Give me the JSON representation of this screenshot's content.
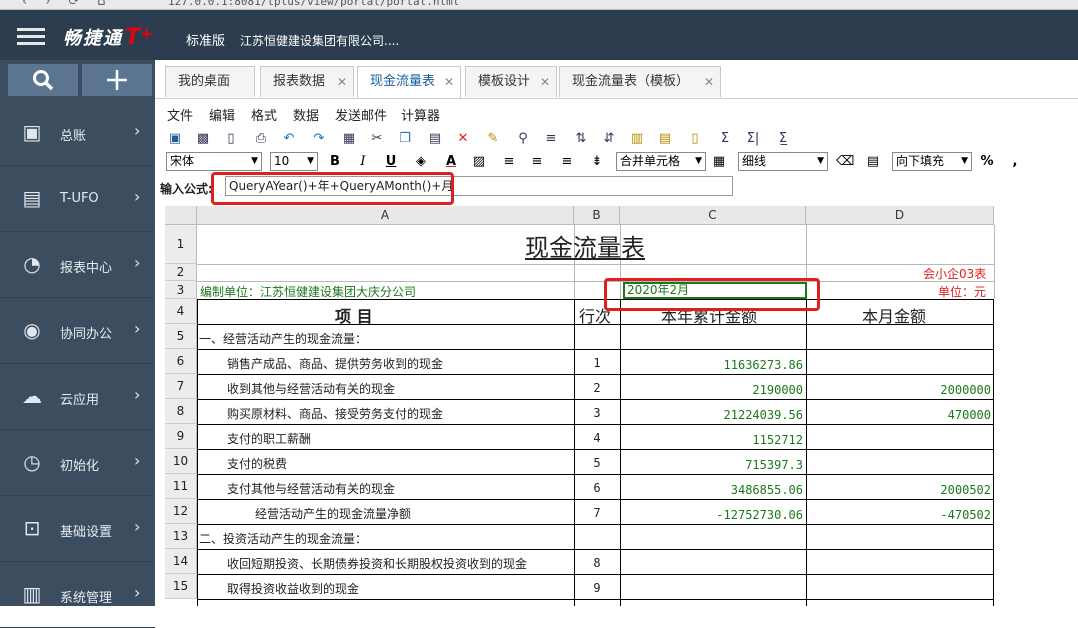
{
  "browser": {
    "url": "127.0.0.1:8081/tplus/view/portal/portal.html"
  },
  "header": {
    "brand": "畅捷通",
    "brand_t": "T",
    "brand_plus": "+",
    "edition": "标准版",
    "company": "江苏恒健建设集团有限公司...."
  },
  "sidebar": {
    "items": [
      {
        "label": "总账",
        "icon": "ledger-icon"
      },
      {
        "label": "T-UFO",
        "icon": "ufo-icon"
      },
      {
        "label": "报表中心",
        "icon": "pie-chart-icon"
      },
      {
        "label": "协同办公",
        "icon": "collab-icon"
      },
      {
        "label": "云应用",
        "icon": "cloud-icon"
      },
      {
        "label": "初始化",
        "icon": "clock-icon"
      },
      {
        "label": "基础设置",
        "icon": "chart-settings-icon"
      },
      {
        "label": "系统管理",
        "icon": "system-icon"
      }
    ]
  },
  "tabs": [
    {
      "label": "我的桌面",
      "closable": false
    },
    {
      "label": "报表数据",
      "closable": true
    },
    {
      "label": "现金流量表",
      "closable": true,
      "active": true
    },
    {
      "label": "模板设计",
      "closable": true
    },
    {
      "label": "现金流量表（模板）",
      "closable": true
    }
  ],
  "menubar": [
    "文件",
    "编辑",
    "格式",
    "数据",
    "发送邮件",
    "计算器"
  ],
  "format_toolbar": {
    "font": "宋体",
    "size": "10",
    "merge": "合并单元格",
    "border": "细线",
    "fill": "向下填充"
  },
  "formula": {
    "label": "输入公式:",
    "value": "QueryAYear()+年+QueryAMonth()+月"
  },
  "columns": [
    "A",
    "B",
    "C",
    "D"
  ],
  "sheet": {
    "title": "现金流量表",
    "form_code": "会小企03表",
    "unit_prefix": "编制单位：江苏恒健建设集团大庆分公司",
    "period": "2020年2月",
    "currency_unit": "单位：元",
    "headers": {
      "item": "项        目",
      "row": "行次",
      "ytd": "本年累计金额",
      "month": "本月金额"
    },
    "rows": [
      {
        "rownum": "5",
        "item": "一、经营活动产生的现金流量：",
        "line": "",
        "ytd": "",
        "month": ""
      },
      {
        "rownum": "6",
        "item": "销售产成品、商品、提供劳务收到的现金",
        "line": "1",
        "ytd": "11636273.86",
        "month": ""
      },
      {
        "rownum": "7",
        "item": "收到其他与经营活动有关的现金",
        "line": "2",
        "ytd": "2190000",
        "month": "2000000"
      },
      {
        "rownum": "8",
        "item": "购买原材料、商品、接受劳务支付的现金",
        "line": "3",
        "ytd": "21224039.56",
        "month": "470000"
      },
      {
        "rownum": "9",
        "item": "支付的职工薪酬",
        "line": "4",
        "ytd": "1152712",
        "month": ""
      },
      {
        "rownum": "10",
        "item": "支付的税费",
        "line": "5",
        "ytd": "715397.3",
        "month": ""
      },
      {
        "rownum": "11",
        "item": "支付其他与经营活动有关的现金",
        "line": "6",
        "ytd": "3486855.06",
        "month": "2000502"
      },
      {
        "rownum": "12",
        "item": "经营活动产生的现金流量净额",
        "line": "7",
        "ytd": "-12752730.06",
        "month": "-470502"
      },
      {
        "rownum": "13",
        "item": "二、投资活动产生的现金流量：",
        "line": "",
        "ytd": "",
        "month": ""
      },
      {
        "rownum": "14",
        "item": "收回短期投资、长期债券投资和长期股权投资收到的现金",
        "line": "8",
        "ytd": "",
        "month": ""
      },
      {
        "rownum": "15",
        "item": "取得投资收益收到的现金",
        "line": "9",
        "ytd": "",
        "month": ""
      }
    ]
  },
  "colors": {
    "topbar": "#2c3d4f",
    "sidebar": "#3c4d5f",
    "accent_red": "#e02020",
    "data_green": "#1a7a1a"
  }
}
